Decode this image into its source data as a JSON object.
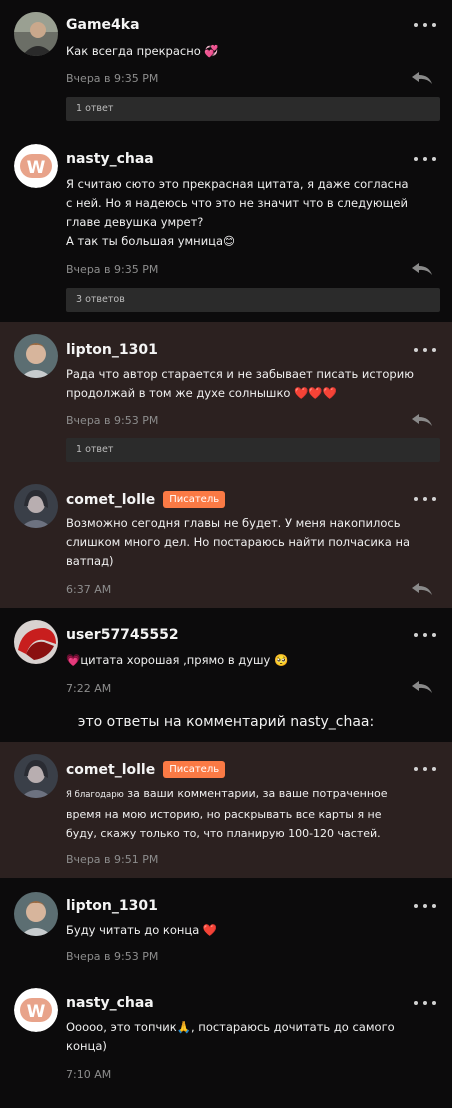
{
  "comments": [
    {
      "username": "Game4ka",
      "text": "Как всегда прекрасно 💞",
      "time": "Вчера в 9:35 PM",
      "replies": "1 ответ",
      "avatar": "man-avatar"
    },
    {
      "username": "nasty_chaa",
      "text": "Я считаю сюто это прекрасная цитата, я даже согласна\nс ней. Но я надеюсь что это не значит что в следующей\nглаве девушка умрет?\nА так ты большая умница😊",
      "time": "Вчера в 9:35 PM",
      "replies": "3 ответов",
      "avatar": "w-logo-avatar"
    },
    {
      "username": "lipton_1301",
      "text": "Рада что автор старается и не забывает писать историю\nпродолжай в том же духе солнышко ❤️❤️❤️",
      "time": "Вчера в 9:53 PM",
      "replies": "1 ответ",
      "avatar": "boy-avatar"
    },
    {
      "username": "comet_lolle",
      "badge": "Писатель",
      "text": "Возможно сегодня главы не будет. У меня накопилось\nслишком много дел. Но постараюсь найти полчасика на\nватпад)",
      "time": "6:37 AM",
      "avatar": "girl-avatar"
    },
    {
      "username": "user57745552",
      "text": "💗цитата хорошая ,прямо в душу 🥺",
      "time": "7:22 AM",
      "avatar": "red-helmet-avatar"
    }
  ],
  "divider": "это ответы на комментарий nasty_chaa:",
  "replies_thread": [
    {
      "username": "comet_lolle",
      "badge": "Писатель",
      "text_small": "Я благодарю",
      "text": " за ваши комментарии, за ваше потраченное\nвремя на мою историю, но раскрывать  все карты я не\nбуду, скажу только то, что планирую 100-120 частей.",
      "time": "Вчера в 9:51 PM",
      "avatar": "girl-avatar"
    },
    {
      "username": "lipton_1301",
      "text": "Буду читать до конца ❤️",
      "time": "Вчера в 9:53 PM",
      "avatar": "boy-avatar"
    },
    {
      "username": "nasty_chaa",
      "text": "Ооооо, это топчик🙏, постараюсь дочитать до самого\nконца)",
      "time": "7:10 AM",
      "avatar": "w-logo-avatar"
    }
  ],
  "colors": {
    "background": "#0c0b0c",
    "highlight": "#2c2120",
    "badge": "#fa7a45",
    "bar": "#2b2b2b"
  }
}
